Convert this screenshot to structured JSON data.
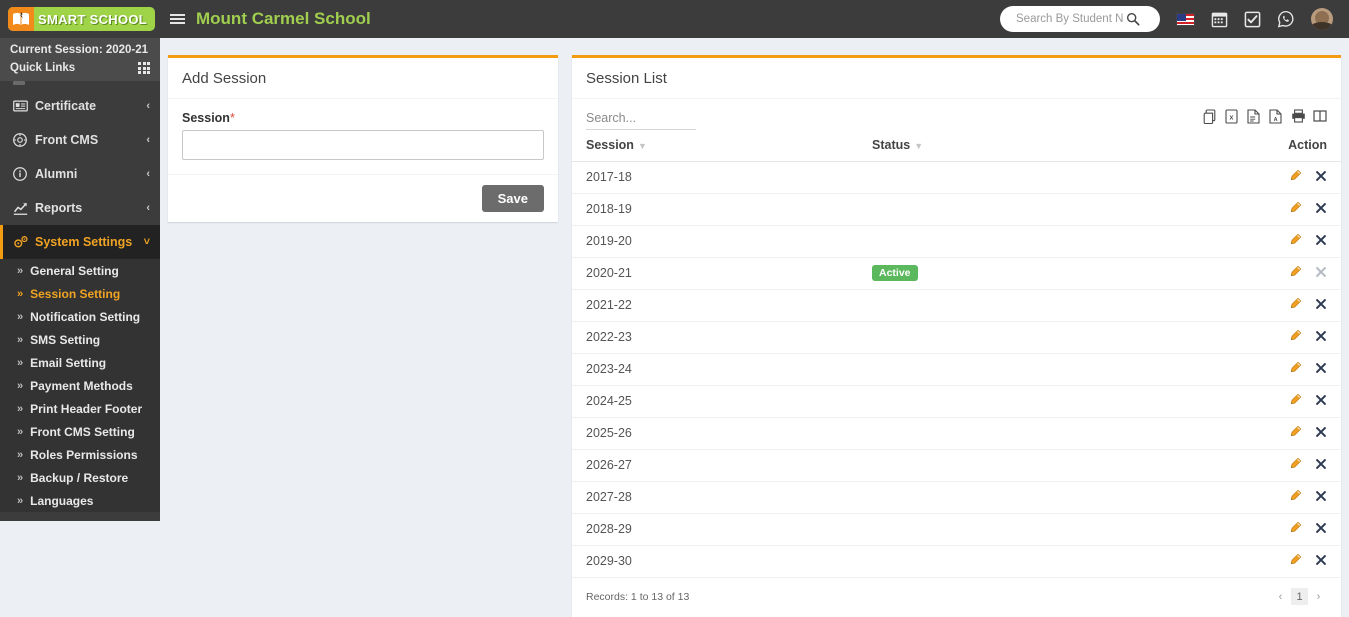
{
  "header": {
    "logo_text": "SMART SCHOOL",
    "school_name": "Mount Carmel School",
    "search_placeholder": "Search By Student Name",
    "search_value": ""
  },
  "sidebar": {
    "current_session_label": "Current Session: 2020-21",
    "quick_links_label": "Quick Links",
    "items": [
      {
        "label": "Certificate",
        "icon": "certificate-icon",
        "caret": "‹"
      },
      {
        "label": "Front CMS",
        "icon": "front-cms-icon",
        "caret": "‹"
      },
      {
        "label": "Alumni",
        "icon": "alumni-icon",
        "caret": "‹"
      },
      {
        "label": "Reports",
        "icon": "reports-icon",
        "caret": "‹"
      },
      {
        "label": "System Settings",
        "icon": "system-settings-icon",
        "caret": "˅"
      }
    ],
    "subitems": [
      {
        "label": "General Setting"
      },
      {
        "label": "Session Setting"
      },
      {
        "label": "Notification Setting"
      },
      {
        "label": "SMS Setting"
      },
      {
        "label": "Email Setting"
      },
      {
        "label": "Payment Methods"
      },
      {
        "label": "Print Header Footer"
      },
      {
        "label": "Front CMS Setting"
      },
      {
        "label": "Roles Permissions"
      },
      {
        "label": "Backup / Restore"
      },
      {
        "label": "Languages"
      }
    ],
    "active_item": "System Settings",
    "active_subitem": "Session Setting",
    "accent_color": "#f39c12"
  },
  "add_session": {
    "title": "Add Session",
    "field_label": "Session",
    "required_mark": "*",
    "field_value": "",
    "field_placeholder": "",
    "save_label": "Save"
  },
  "session_list": {
    "title": "Session List",
    "search_placeholder": "Search...",
    "search_value": "",
    "export_icons": [
      "copy-icon",
      "excel-icon",
      "csv-icon",
      "pdf-icon",
      "print-icon",
      "column-visibility-icon"
    ],
    "columns": [
      "Session",
      "Status",
      "Action"
    ],
    "rows": [
      {
        "session": "2017-18",
        "status": "",
        "delete_enabled": true
      },
      {
        "session": "2018-19",
        "status": "",
        "delete_enabled": true
      },
      {
        "session": "2019-20",
        "status": "",
        "delete_enabled": true
      },
      {
        "session": "2020-21",
        "status": "Active",
        "delete_enabled": false
      },
      {
        "session": "2021-22",
        "status": "",
        "delete_enabled": true
      },
      {
        "session": "2022-23",
        "status": "",
        "delete_enabled": true
      },
      {
        "session": "2023-24",
        "status": "",
        "delete_enabled": true
      },
      {
        "session": "2024-25",
        "status": "",
        "delete_enabled": true
      },
      {
        "session": "2025-26",
        "status": "",
        "delete_enabled": true
      },
      {
        "session": "2026-27",
        "status": "",
        "delete_enabled": true
      },
      {
        "session": "2027-28",
        "status": "",
        "delete_enabled": true
      },
      {
        "session": "2028-29",
        "status": "",
        "delete_enabled": true
      },
      {
        "session": "2029-30",
        "status": "",
        "delete_enabled": true
      }
    ],
    "records_text": "Records: 1 to 13 of 13",
    "pagination": {
      "prev": "‹",
      "pages": [
        "1"
      ],
      "next": "›",
      "current": "1"
    },
    "active_badge_color": "#5cb85c"
  }
}
